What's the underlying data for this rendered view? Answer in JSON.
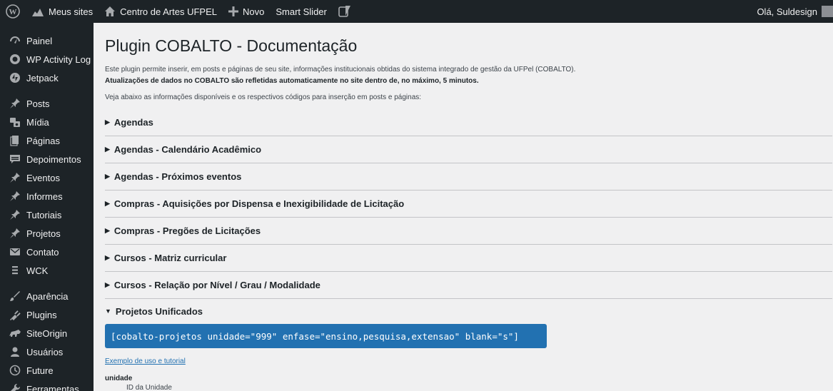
{
  "adminbar": {
    "my_sites": "Meus sites",
    "site_name": "Centro de Artes UFPEL",
    "new": "Novo",
    "smart_slider": "Smart Slider",
    "greeting": "Olá, Suldesign"
  },
  "sidebar": {
    "items": [
      {
        "label": "Painel",
        "icon": "dashboard-icon"
      },
      {
        "label": "WP Activity Log",
        "icon": "activity-log-icon"
      },
      {
        "label": "Jetpack",
        "icon": "jetpack-icon"
      },
      {
        "label": "Posts",
        "icon": "pin-icon"
      },
      {
        "label": "Mídia",
        "icon": "media-icon"
      },
      {
        "label": "Páginas",
        "icon": "page-icon"
      },
      {
        "label": "Depoimentos",
        "icon": "testimonial-icon"
      },
      {
        "label": "Eventos",
        "icon": "pin-icon"
      },
      {
        "label": "Informes",
        "icon": "pin-icon"
      },
      {
        "label": "Tutoriais",
        "icon": "pin-icon"
      },
      {
        "label": "Projetos",
        "icon": "pin-icon"
      },
      {
        "label": "Contato",
        "icon": "mail-icon"
      },
      {
        "label": "WCK",
        "icon": "wck-icon"
      },
      {
        "label": "Aparência",
        "icon": "appearance-icon"
      },
      {
        "label": "Plugins",
        "icon": "plugin-icon"
      },
      {
        "label": "SiteOrigin",
        "icon": "siteorigin-icon"
      },
      {
        "label": "Usuários",
        "icon": "user-icon"
      },
      {
        "label": "Future",
        "icon": "clock-icon"
      },
      {
        "label": "Ferramentas",
        "icon": "tools-icon"
      }
    ]
  },
  "page": {
    "title": "Plugin COBALTO - Documentação",
    "description": "Este plugin permite inserir, em posts e páginas de seu site, informações institucionais obtidas do sistema integrado de gestão da UFPel (COBALTO).",
    "update_note": "Atualizações de dados no COBALTO são refletidas automaticamente no site dentro de, no máximo, 5 minutos.",
    "lead": "Veja abaixo as informações disponíveis e os respectivos códigos para inserção em posts e páginas:",
    "sections": [
      "Agendas",
      "Agendas - Calendário Acadêmico",
      "Agendas - Próximos eventos",
      "Compras - Aquisições por Dispensa e Inexigibilidade de Licitação",
      "Compras - Pregões de Licitações",
      "Cursos - Matriz curricular",
      "Cursos - Relação por Nível / Grau / Modalidade"
    ],
    "open_section": {
      "title": "Projetos Unificados",
      "shortcode": "[cobalto-projetos unidade=\"999\" enfase=\"ensino,pesquisa,extensao\" blank=\"s\"]",
      "tutorial_link": "Exemplo de uso e tutorial",
      "param_name": "unidade",
      "param_desc": "ID da Unidade"
    }
  },
  "colors": {
    "adminbar_bg": "#1d2327",
    "sidebar_bg": "#1d2327",
    "accent": "#2271b1",
    "content_bg": "#f0f0f1"
  }
}
